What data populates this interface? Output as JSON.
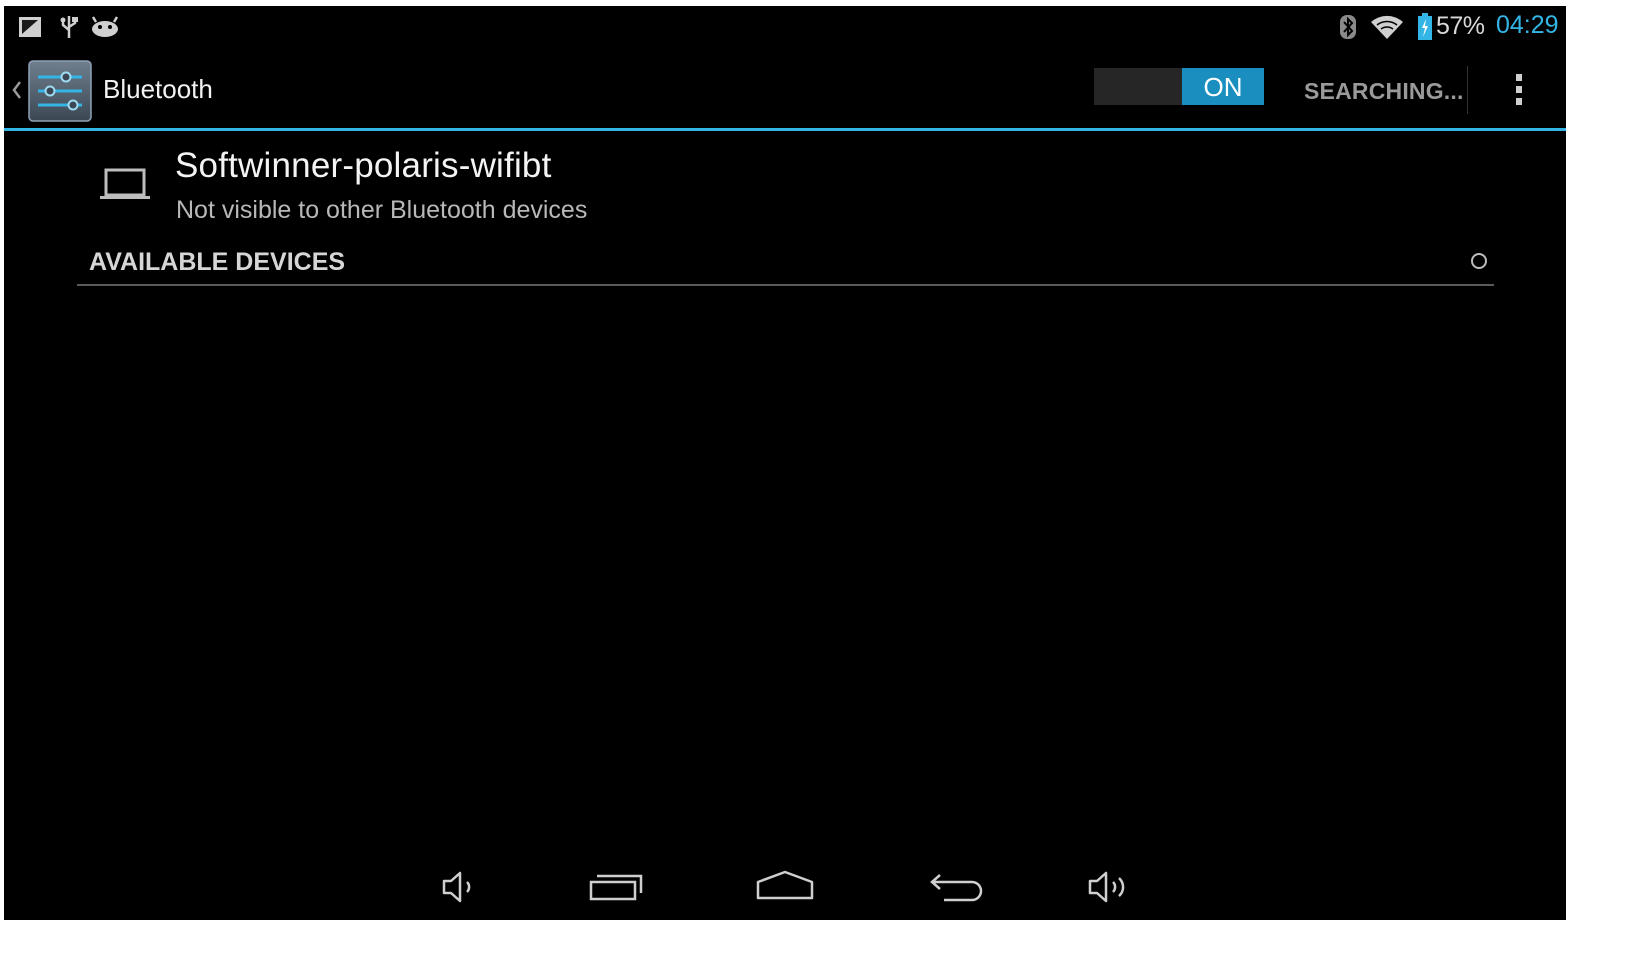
{
  "status_bar": {
    "battery_percent": "57%",
    "time": "04:29",
    "icons": [
      "screenshot-icon",
      "usb-icon",
      "android-debug-icon",
      "bluetooth-icon",
      "wifi-icon",
      "battery-icon"
    ]
  },
  "action_bar": {
    "title": "Bluetooth",
    "app_icon": "settings-icon",
    "toggle_label": "ON",
    "status": "SEARCHING...",
    "overflow_icon": "overflow-menu-icon"
  },
  "device": {
    "name": "Softwinner-polaris-wifibt",
    "visibility": "Not visible to other Bluetooth devices",
    "icon": "laptop-icon"
  },
  "available_section": {
    "header": "AVAILABLE DEVICES",
    "progress_icon": "spinner-icon"
  },
  "nav_bar": {
    "buttons": [
      "volume-down-icon",
      "recent-apps-icon",
      "home-icon",
      "back-icon",
      "volume-up-icon"
    ]
  },
  "colors": {
    "accent": "#33b5e5",
    "toggle_on": "#1a8fbf",
    "background": "#000000"
  }
}
